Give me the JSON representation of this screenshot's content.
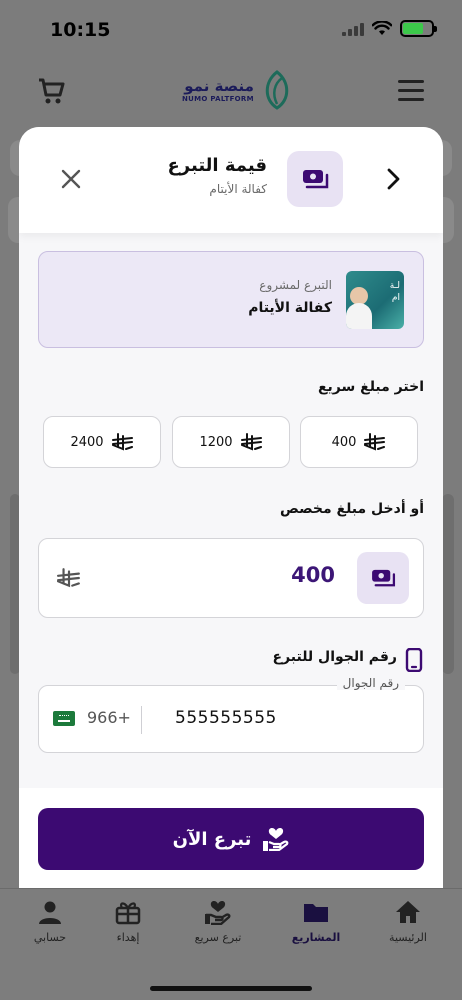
{
  "status_bar": {
    "time": "10:15"
  },
  "header": {
    "logo_ar": "منصة نمو",
    "logo_en": "NUMO PALTFORM",
    "cart_icon": "cart-icon",
    "menu_icon": "hamburger-menu-icon"
  },
  "modal": {
    "title": "قيمة التبرع",
    "subtitle": "كفالة الأيتام",
    "project": {
      "label": "التبرع لمشروع",
      "name": "كفالة الأيتام",
      "thumb_text": "لـة\nام"
    },
    "quick_amount_title": "اختر مبلغ سريع",
    "quick_amounts": [
      "2400",
      "1200",
      "400"
    ],
    "custom_amount_title": "أو أدخل مبلغ مخصص",
    "custom_amount_value": "400",
    "phone_section_title": "رقم الجوال للتبرع",
    "phone_field": {
      "legend": "رقم الجوال",
      "value": "555555555",
      "country_code": "966+"
    },
    "donate_button": "تبرع الآن"
  },
  "bottom_nav": {
    "items": [
      {
        "label": "حسابي",
        "icon": "person-icon"
      },
      {
        "label": "إهداء",
        "icon": "gift-icon"
      },
      {
        "label": "تبرع سريع",
        "icon": "hand-heart-icon"
      },
      {
        "label": "المشاريع",
        "icon": "folder-icon",
        "active": true
      },
      {
        "label": "الرئيسية",
        "icon": "home-icon"
      }
    ]
  },
  "colors": {
    "primary": "#3c0a72",
    "accent_light": "#e8e2f3",
    "amount_text": "#3c1676",
    "overlay": "#7c7c7c"
  }
}
